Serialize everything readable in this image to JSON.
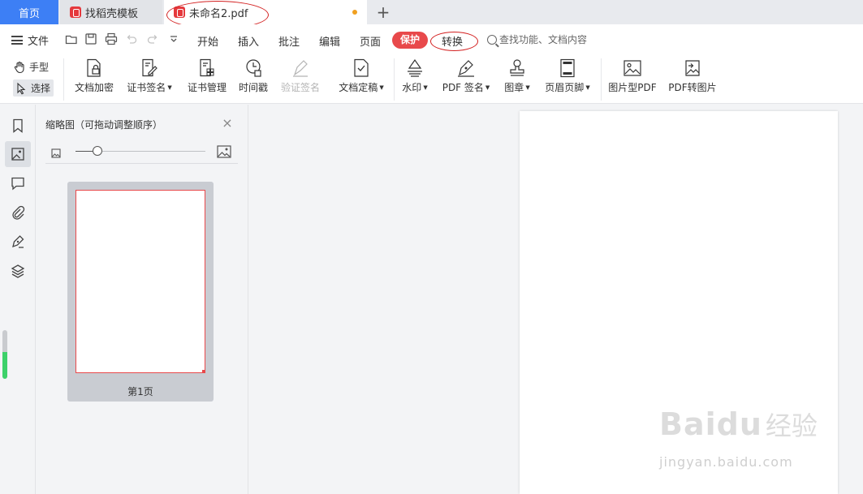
{
  "tabs": {
    "home": "首页",
    "template": "找稻壳模板",
    "document": "未命名2.pdf"
  },
  "menu": {
    "file": "文件",
    "items": [
      "开始",
      "插入",
      "批注",
      "编辑",
      "页面"
    ],
    "protect": "保护",
    "convert": "转换",
    "search_placeholder": "查找功能、文档内容"
  },
  "ribbon": {
    "hand": "手型",
    "select": "选择",
    "tools": [
      {
        "label": "文档加密",
        "icon": "document-lock-icon"
      },
      {
        "label": "证书签名",
        "icon": "certificate-sign-icon",
        "dropdown": true
      },
      {
        "label": "证书管理",
        "icon": "certificate-manage-icon"
      },
      {
        "label": "时间戳",
        "icon": "timestamp-icon"
      },
      {
        "label": "验证签名",
        "icon": "verify-signature-icon",
        "disabled": true
      },
      {
        "label": "文档定稿",
        "icon": "document-finalize-icon",
        "dropdown": true
      },
      {
        "label": "水印",
        "icon": "watermark-icon",
        "dropdown": true
      },
      {
        "label": "PDF 签名",
        "icon": "pdf-sign-icon",
        "dropdown": true
      },
      {
        "label": "图章",
        "icon": "stamp-icon",
        "dropdown": true
      },
      {
        "label": "页眉页脚",
        "icon": "header-footer-icon",
        "dropdown": true
      },
      {
        "label": "图片型PDF",
        "icon": "image-pdf-icon"
      },
      {
        "label": "PDF转图片",
        "icon": "pdf-to-image-icon"
      }
    ]
  },
  "panel": {
    "title": "缩略图（可拖动调整顺序）",
    "zoom_level": 0.17,
    "page_label": "第1页"
  },
  "watermark": {
    "brand": "Baidu",
    "brand_cn": "经验",
    "url": "jingyan.baidu.com"
  },
  "colors": {
    "accent": "#3d7ff5",
    "protect": "#e8494b",
    "annotation": "#d32020"
  }
}
